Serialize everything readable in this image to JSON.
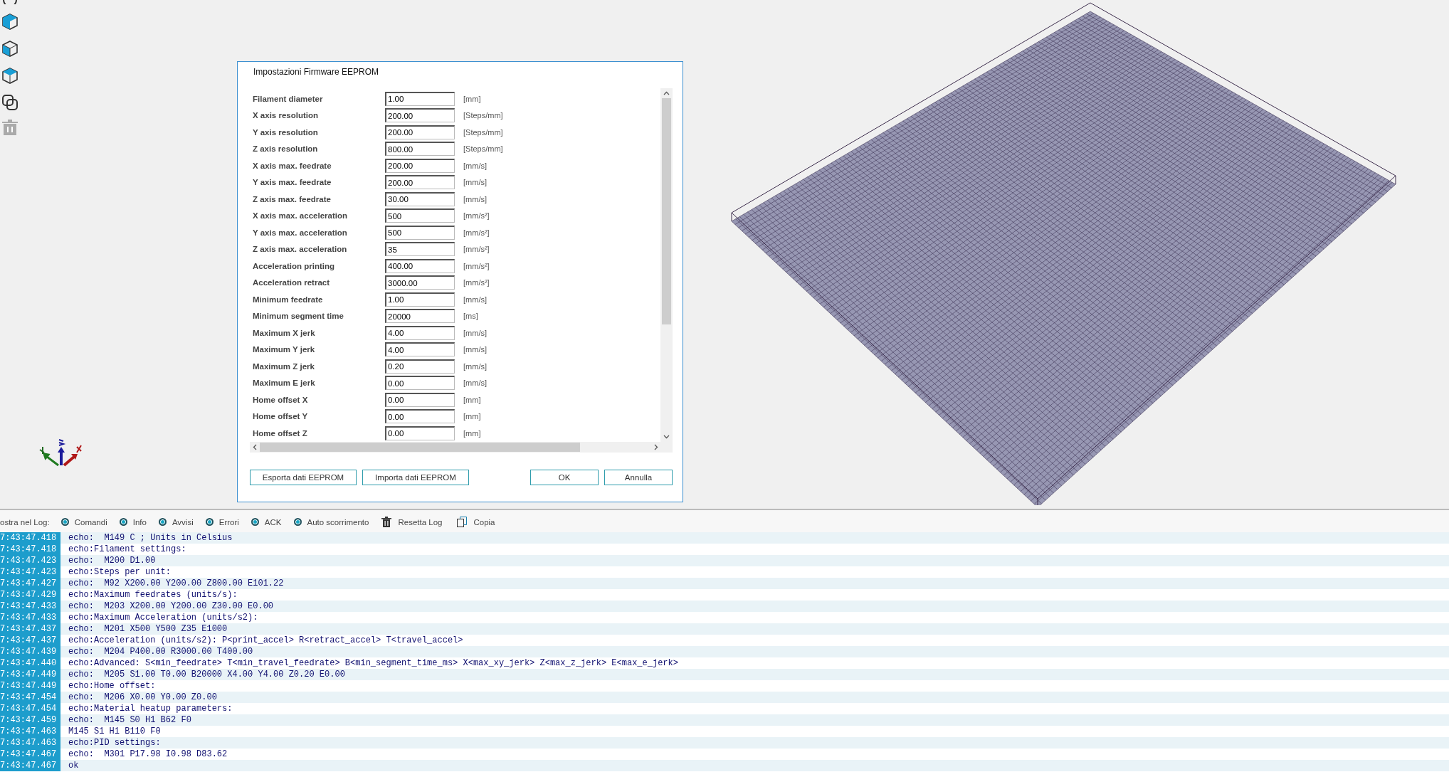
{
  "window": {
    "title": "Impostazioni Firmware EEPROM"
  },
  "eeprom_rows": [
    {
      "label": "Filament diameter",
      "value": "1.00",
      "unit": "[mm]"
    },
    {
      "label": "X axis resolution",
      "value": "200.00",
      "unit": "[Steps/mm]"
    },
    {
      "label": "Y axis resolution",
      "value": "200.00",
      "unit": "[Steps/mm]"
    },
    {
      "label": "Z axis resolution",
      "value": "800.00",
      "unit": "[Steps/mm]"
    },
    {
      "label": "X axis max. feedrate",
      "value": "200.00",
      "unit": "[mm/s]"
    },
    {
      "label": "Y axis max. feedrate",
      "value": "200.00",
      "unit": "[mm/s]"
    },
    {
      "label": "Z axis max. feedrate",
      "value": "30.00",
      "unit": "[mm/s]"
    },
    {
      "label": "X axis max. acceleration",
      "value": "500",
      "unit": "[mm/s²]"
    },
    {
      "label": "Y axis max. acceleration",
      "value": "500",
      "unit": "[mm/s²]"
    },
    {
      "label": "Z axis max. acceleration",
      "value": "35",
      "unit": "[mm/s²]"
    },
    {
      "label": "Acceleration printing",
      "value": "400.00",
      "unit": "[mm/s²]"
    },
    {
      "label": "Acceleration retract",
      "value": "3000.00",
      "unit": "[mm/s²]"
    },
    {
      "label": "Minimum feedrate",
      "value": "1.00",
      "unit": "[mm/s]"
    },
    {
      "label": "Minimum segment time",
      "value": "20000",
      "unit": "[ms]"
    },
    {
      "label": "Maximum X jerk",
      "value": "4.00",
      "unit": "[mm/s]"
    },
    {
      "label": "Maximum Y jerk",
      "value": "4.00",
      "unit": "[mm/s]"
    },
    {
      "label": "Maximum Z jerk",
      "value": "0.20",
      "unit": "[mm/s]"
    },
    {
      "label": "Maximum E jerk",
      "value": "0.00",
      "unit": "[mm/s]"
    },
    {
      "label": "Home offset X",
      "value": "0.00",
      "unit": "[mm]"
    },
    {
      "label": "Home offset Y",
      "value": "0.00",
      "unit": "[mm]"
    },
    {
      "label": "Home offset Z",
      "value": "0.00",
      "unit": "[mm]"
    }
  ],
  "eeprom_buttons": [
    {
      "label": "Esporta dati EEPROM"
    },
    {
      "label": "Importa dati EEPROM"
    }
  ],
  "dialog_buttons": [
    {
      "label": "OK"
    },
    {
      "label": "Annulla"
    }
  ],
  "log_toolbar": {
    "label": "ostra nel Log:",
    "filters": [
      {
        "label": "Comandi",
        "checked": true
      },
      {
        "label": "Info",
        "checked": true
      },
      {
        "label": "Avvisi",
        "checked": true
      },
      {
        "label": "Errori",
        "checked": true
      },
      {
        "label": "ACK",
        "checked": true
      },
      {
        "label": "Auto scorrimento",
        "checked": true
      }
    ],
    "actions": [
      {
        "label": "Resetta Log",
        "kind": "trash"
      },
      {
        "label": "Copia",
        "kind": "copy"
      }
    ]
  },
  "log": [
    {
      "time": "7:43:47.418",
      "text": "echo:  M149 C ; Units in Celsius"
    },
    {
      "time": "7:43:47.418",
      "text": "echo:Filament settings:"
    },
    {
      "time": "7:43:47.423",
      "text": "echo:  M200 D1.00"
    },
    {
      "time": "7:43:47.423",
      "text": "echo:Steps per unit:"
    },
    {
      "time": "7:43:47.427",
      "text": "echo:  M92 X200.00 Y200.00 Z800.00 E101.22"
    },
    {
      "time": "7:43:47.429",
      "text": "echo:Maximum feedrates (units/s):"
    },
    {
      "time": "7:43:47.433",
      "text": "echo:  M203 X200.00 Y200.00 Z30.00 E0.00"
    },
    {
      "time": "7:43:47.433",
      "text": "echo:Maximum Acceleration (units/s2):"
    },
    {
      "time": "7:43:47.437",
      "text": "echo:  M201 X500 Y500 Z35 E1000"
    },
    {
      "time": "7:43:47.437",
      "text": "echo:Acceleration (units/s2): P<print_accel> R<retract_accel> T<travel_accel>"
    },
    {
      "time": "7:43:47.439",
      "text": "echo:  M204 P400.00 R3000.00 T400.00"
    },
    {
      "time": "7:43:47.440",
      "text": "echo:Advanced: S<min_feedrate> T<min_travel_feedrate> B<min_segment_time_ms> X<max_xy_jerk> Z<max_z_jerk> E<max_e_jerk>"
    },
    {
      "time": "7:43:47.449",
      "text": "echo:  M205 S1.00 T0.00 B20000 X4.00 Y4.00 Z0.20 E0.00"
    },
    {
      "time": "7:43:47.449",
      "text": "echo:Home offset:"
    },
    {
      "time": "7:43:47.454",
      "text": "echo:  M206 X0.00 Y0.00 Z0.00"
    },
    {
      "time": "7:43:47.454",
      "text": "echo:Material heatup parameters:"
    },
    {
      "time": "7:43:47.459",
      "text": "echo:  M145 S0 H1 B62 F0"
    },
    {
      "time": "7:43:47.463",
      "text": "M145 S1 H1 B110 F0"
    },
    {
      "time": "7:43:47.463",
      "text": "echo:PID settings:"
    },
    {
      "time": "7:43:47.467",
      "text": "echo:  M301 P17.98 I0.98 D83.62"
    },
    {
      "time": "7:43:47.467",
      "text": "ok"
    }
  ]
}
